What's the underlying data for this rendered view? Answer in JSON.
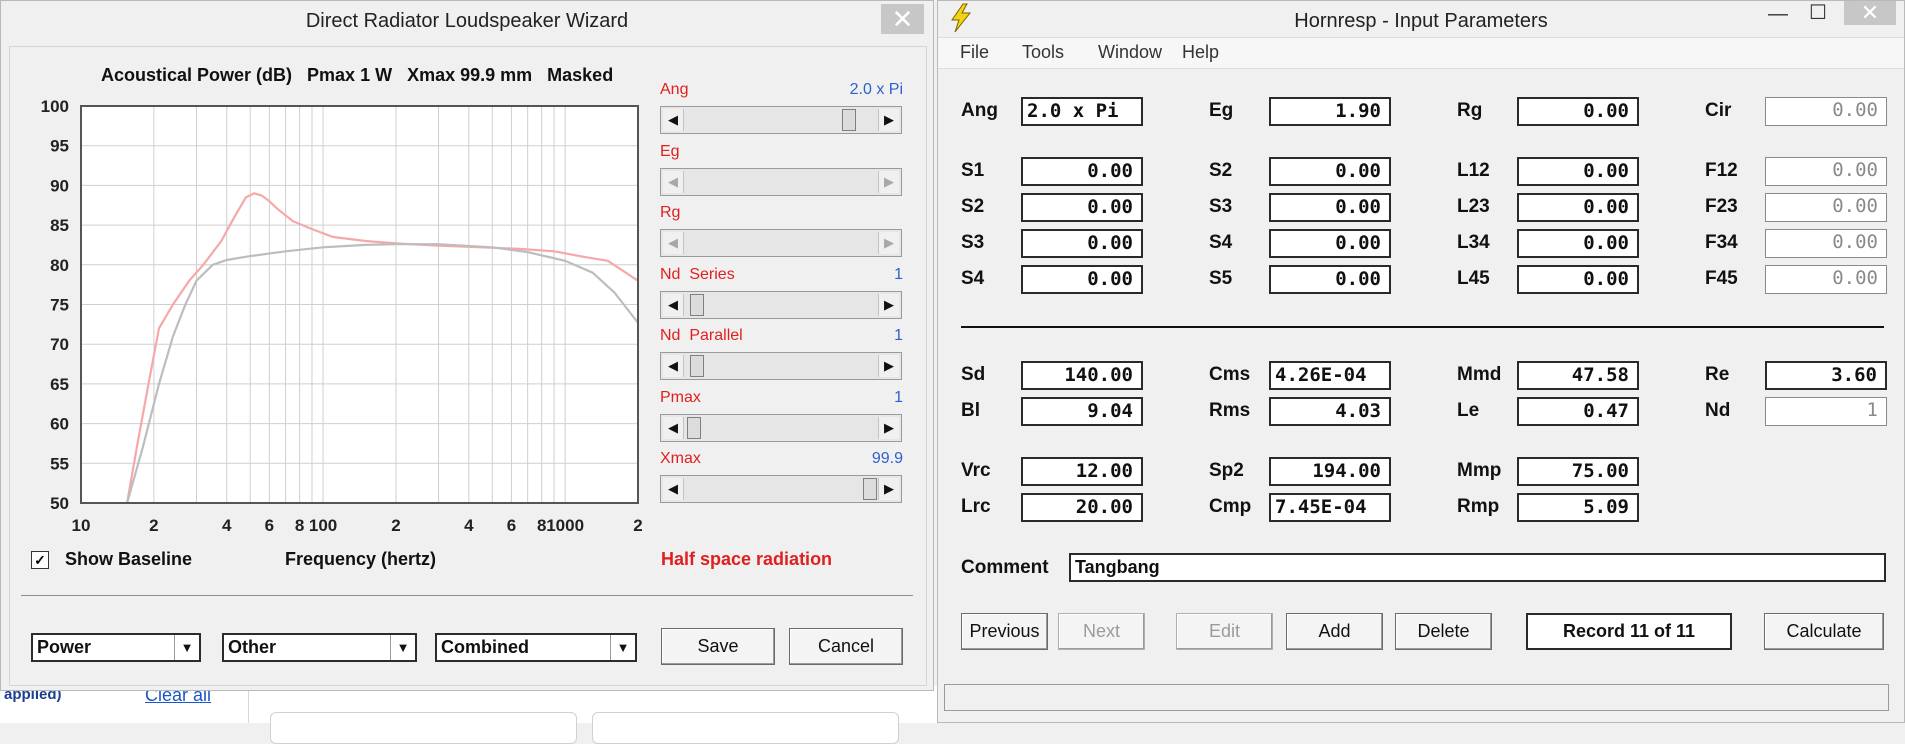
{
  "wizard": {
    "title": "Direct Radiator Loudspeaker Wizard",
    "chart_header": "Acoustical Power (dB)   Pmax 1 W   Xmax 99.9 mm   Masked",
    "x_axis_label": "Frequency (hertz)",
    "show_baseline_label": "Show Baseline",
    "show_baseline_checked": true,
    "radiation_text": "Half space radiation",
    "sliders": [
      {
        "name": "Ang",
        "value": "2.0 x Pi",
        "position": 0.88,
        "enabled": true
      },
      {
        "name": "Eg",
        "value": "",
        "position": 0.0,
        "enabled": false
      },
      {
        "name": "Rg",
        "value": "",
        "position": 0.0,
        "enabled": false
      },
      {
        "name": "Nd  Series",
        "value": "1",
        "position": 0.03,
        "enabled": true
      },
      {
        "name": "Nd  Parallel",
        "value": "1",
        "position": 0.03,
        "enabled": true
      },
      {
        "name": "Pmax",
        "value": "1",
        "position": 0.01,
        "enabled": true
      },
      {
        "name": "Xmax",
        "value": "99.9",
        "position": 1.0,
        "enabled": true
      }
    ],
    "selects": [
      "Power",
      "Other",
      "Combined"
    ],
    "save_label": "Save",
    "cancel_label": "Cancel",
    "close_glyph": "✕"
  },
  "hornresp": {
    "title": "Hornresp - Input Parameters",
    "menu": [
      "File",
      "Tools",
      "Window",
      "Help"
    ],
    "fields_top": [
      {
        "label": "Ang",
        "value": "2.0 x Pi",
        "align": "left"
      },
      {
        "label": "Eg",
        "value": "1.90"
      },
      {
        "label": "Rg",
        "value": "0.00"
      },
      {
        "label": "Cir",
        "value": "0.00",
        "disabled": true
      }
    ],
    "fields_grid": [
      [
        {
          "label": "S1",
          "value": "0.00"
        },
        {
          "label": "S2",
          "value": "0.00"
        },
        {
          "label": "L12",
          "value": "0.00"
        },
        {
          "label": "F12",
          "value": "0.00",
          "disabled": true
        }
      ],
      [
        {
          "label": "S2",
          "value": "0.00"
        },
        {
          "label": "S3",
          "value": "0.00"
        },
        {
          "label": "L23",
          "value": "0.00"
        },
        {
          "label": "F23",
          "value": "0.00",
          "disabled": true
        }
      ],
      [
        {
          "label": "S3",
          "value": "0.00"
        },
        {
          "label": "S4",
          "value": "0.00"
        },
        {
          "label": "L34",
          "value": "0.00"
        },
        {
          "label": "F34",
          "value": "0.00",
          "disabled": true
        }
      ],
      [
        {
          "label": "S4",
          "value": "0.00"
        },
        {
          "label": "S5",
          "value": "0.00"
        },
        {
          "label": "L45",
          "value": "0.00"
        },
        {
          "label": "F45",
          "value": "0.00",
          "disabled": true
        }
      ]
    ],
    "driver": [
      [
        {
          "label": "Sd",
          "value": "140.00"
        },
        {
          "label": "Cms",
          "value": "4.26E-04",
          "align": "left"
        },
        {
          "label": "Mmd",
          "value": "47.58"
        },
        {
          "label": "Re",
          "value": "3.60"
        }
      ],
      [
        {
          "label": "Bl",
          "value": "9.04"
        },
        {
          "label": "Rms",
          "value": "4.03"
        },
        {
          "label": "Le",
          "value": "0.47"
        },
        {
          "label": "Nd",
          "value": "1",
          "disabled": true
        }
      ]
    ],
    "chamber": [
      [
        {
          "label": "Vrc",
          "value": "12.00"
        },
        {
          "label": "Sp2",
          "value": "194.00"
        },
        {
          "label": "Mmp",
          "value": "75.00"
        }
      ],
      [
        {
          "label": "Lrc",
          "value": "20.00"
        },
        {
          "label": "Cmp",
          "value": "7.45E-04",
          "align": "left"
        },
        {
          "label": "Rmp",
          "value": "5.09"
        }
      ]
    ],
    "comment_label": "Comment",
    "comment_value": "Tangbang",
    "buttons": {
      "previous": "Previous",
      "next": "Next",
      "edit": "Edit",
      "add": "Add",
      "delete": "Delete",
      "record": "Record 11 of 11",
      "calculate": "Calculate"
    },
    "window_controls": [
      "—",
      "☐",
      "✕"
    ]
  },
  "background": {
    "link_text": "Clear all",
    "partial_text": "applied)"
  },
  "chart_data": {
    "type": "line",
    "title": "Acoustical Power (dB)   Pmax 1 W   Xmax 99.9 mm   Masked",
    "xlabel": "Frequency (hertz)",
    "ylabel": "",
    "x_scale": "log",
    "xlim": [
      10,
      2000
    ],
    "ylim": [
      50,
      100
    ],
    "y_ticks": [
      100,
      95,
      90,
      85,
      80,
      75,
      70,
      65,
      60,
      55,
      50
    ],
    "x_tick_labels": [
      {
        "x": 10,
        "label": "10"
      },
      {
        "x": 20,
        "label": "2"
      },
      {
        "x": 40,
        "label": "4"
      },
      {
        "x": 60,
        "label": "6"
      },
      {
        "x": 80,
        "label": "8"
      },
      {
        "x": 100,
        "label": "100"
      },
      {
        "x": 200,
        "label": "2"
      },
      {
        "x": 400,
        "label": "4"
      },
      {
        "x": 600,
        "label": "6"
      },
      {
        "x": 800,
        "label": "8"
      },
      {
        "x": 1000,
        "label": "1000"
      },
      {
        "x": 2000,
        "label": "2"
      }
    ],
    "grid": true,
    "series": [
      {
        "color": "#f6a8a8",
        "x": [
          15.5,
          17,
          19,
          21,
          24,
          28,
          32,
          38,
          43,
          48,
          52,
          56,
          60,
          65,
          75,
          90,
          110,
          150,
          200,
          300,
          450,
          650,
          900,
          1200,
          1500,
          2000
        ],
        "y": [
          50,
          57,
          65,
          72,
          75,
          78,
          80,
          83,
          86,
          88.5,
          89,
          88.7,
          88,
          87,
          85.5,
          84.5,
          83.5,
          83,
          82.7,
          82.4,
          82.2,
          82,
          81.7,
          81,
          80.5,
          78
        ]
      },
      {
        "color": "#bdbdbd",
        "x": [
          15.5,
          18,
          21,
          24,
          27,
          30,
          35,
          40,
          50,
          70,
          100,
          150,
          200,
          300,
          500,
          700,
          1000,
          1300,
          1600,
          2000
        ],
        "y": [
          50,
          57,
          65,
          71,
          75,
          78,
          80,
          80.6,
          81.1,
          81.7,
          82.2,
          82.5,
          82.6,
          82.6,
          82.2,
          81.6,
          80.5,
          79,
          76.5,
          72.7
        ]
      }
    ]
  }
}
